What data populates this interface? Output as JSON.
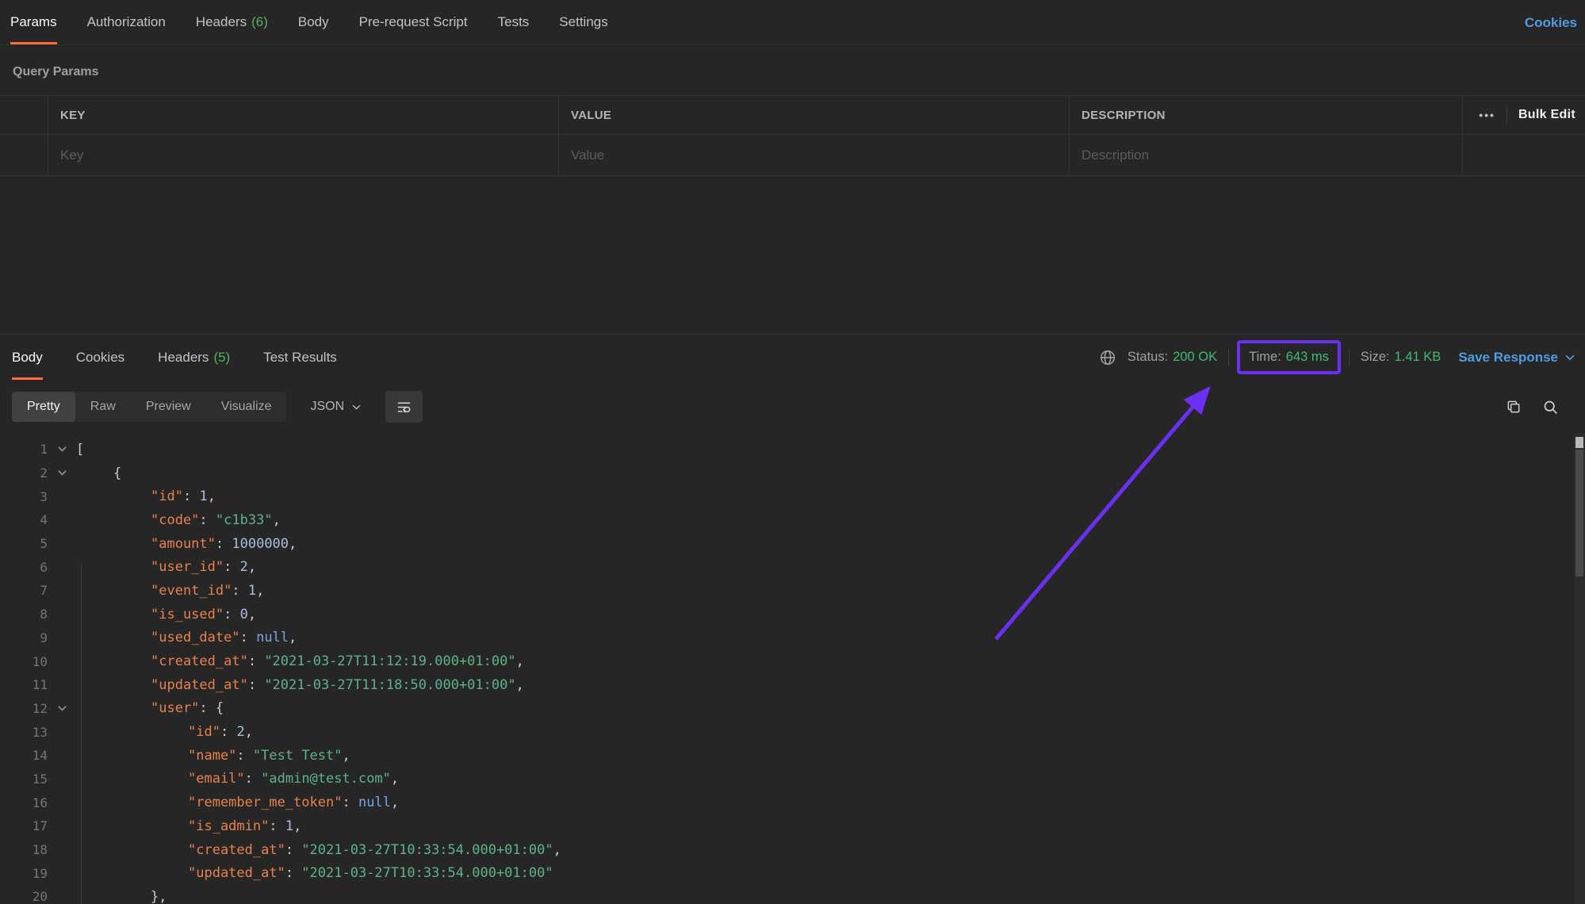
{
  "colors": {
    "accent_orange": "#ff6c37",
    "count_green": "#55b25f",
    "status_green": "#3ebd72",
    "link_blue": "#4f9ce0",
    "annotation_purple": "#6a2ff0",
    "tok_key": "#e8824d",
    "tok_str": "#5fb389",
    "tok_num": "#aabfdb",
    "tok_null": "#7ba3e3",
    "tok_punc": "#cccccc"
  },
  "request_tabs": {
    "items": [
      {
        "label": "Params"
      },
      {
        "label": "Authorization"
      },
      {
        "label": "Headers",
        "count": "(6)"
      },
      {
        "label": "Body"
      },
      {
        "label": "Pre-request Script"
      },
      {
        "label": "Tests"
      },
      {
        "label": "Settings"
      }
    ],
    "cookies_link": "Cookies"
  },
  "query_params": {
    "title": "Query Params",
    "columns": {
      "key": "KEY",
      "value": "VALUE",
      "description": "DESCRIPTION"
    },
    "more_icon": "•••",
    "bulk_edit_label": "Bulk Edit",
    "placeholders": {
      "key": "Key",
      "value": "Value",
      "description": "Description"
    }
  },
  "response": {
    "tabs": [
      {
        "label": "Body"
      },
      {
        "label": "Cookies"
      },
      {
        "label": "Headers",
        "count": "(5)"
      },
      {
        "label": "Test Results"
      }
    ],
    "status": {
      "label": "Status:",
      "value": "200 OK"
    },
    "time": {
      "label": "Time:",
      "value": "643 ms"
    },
    "size": {
      "label": "Size:",
      "value": "1.41 KB"
    },
    "save_response_label": "Save Response",
    "view_modes": [
      "Pretty",
      "Raw",
      "Preview",
      "Visualize"
    ],
    "format_selected": "JSON"
  },
  "icons": {
    "more_actions": "•••",
    "named": [
      "globe-icon",
      "chevron-down-icon",
      "text-wrap-icon",
      "copy-icon",
      "search-icon",
      "fold-chevron-icon"
    ]
  },
  "code": {
    "lines": [
      {
        "n": 1,
        "fold": true,
        "indent": 0,
        "t": [
          [
            "b",
            "["
          ]
        ]
      },
      {
        "n": 2,
        "fold": true,
        "indent": 1,
        "t": [
          [
            "b",
            "{"
          ]
        ]
      },
      {
        "n": 3,
        "fold": false,
        "indent": 2,
        "t": [
          [
            "k",
            "\"id\""
          ],
          [
            "p",
            ": "
          ],
          [
            "n",
            "1"
          ],
          [
            "p",
            ","
          ]
        ]
      },
      {
        "n": 4,
        "fold": false,
        "indent": 2,
        "t": [
          [
            "k",
            "\"code\""
          ],
          [
            "p",
            ": "
          ],
          [
            "s",
            "\"c1b33\""
          ],
          [
            "p",
            ","
          ]
        ]
      },
      {
        "n": 5,
        "fold": false,
        "indent": 2,
        "t": [
          [
            "k",
            "\"amount\""
          ],
          [
            "p",
            ": "
          ],
          [
            "n",
            "1000000"
          ],
          [
            "p",
            ","
          ]
        ]
      },
      {
        "n": 6,
        "fold": false,
        "indent": 2,
        "t": [
          [
            "k",
            "\"user_id\""
          ],
          [
            "p",
            ": "
          ],
          [
            "n",
            "2"
          ],
          [
            "p",
            ","
          ]
        ]
      },
      {
        "n": 7,
        "fold": false,
        "indent": 2,
        "t": [
          [
            "k",
            "\"event_id\""
          ],
          [
            "p",
            ": "
          ],
          [
            "n",
            "1"
          ],
          [
            "p",
            ","
          ]
        ]
      },
      {
        "n": 8,
        "fold": false,
        "indent": 2,
        "t": [
          [
            "k",
            "\"is_used\""
          ],
          [
            "p",
            ": "
          ],
          [
            "n",
            "0"
          ],
          [
            "p",
            ","
          ]
        ]
      },
      {
        "n": 9,
        "fold": false,
        "indent": 2,
        "t": [
          [
            "k",
            "\"used_date\""
          ],
          [
            "p",
            ": "
          ],
          [
            "u",
            "null"
          ],
          [
            "p",
            ","
          ]
        ]
      },
      {
        "n": 10,
        "fold": false,
        "indent": 2,
        "t": [
          [
            "k",
            "\"created_at\""
          ],
          [
            "p",
            ": "
          ],
          [
            "s",
            "\"2021-03-27T11:12:19.000+01:00\""
          ],
          [
            "p",
            ","
          ]
        ]
      },
      {
        "n": 11,
        "fold": false,
        "indent": 2,
        "t": [
          [
            "k",
            "\"updated_at\""
          ],
          [
            "p",
            ": "
          ],
          [
            "s",
            "\"2021-03-27T11:18:50.000+01:00\""
          ],
          [
            "p",
            ","
          ]
        ]
      },
      {
        "n": 12,
        "fold": true,
        "indent": 2,
        "t": [
          [
            "k",
            "\"user\""
          ],
          [
            "p",
            ": "
          ],
          [
            "b",
            "{"
          ]
        ]
      },
      {
        "n": 13,
        "fold": false,
        "indent": 3,
        "t": [
          [
            "k",
            "\"id\""
          ],
          [
            "p",
            ": "
          ],
          [
            "n",
            "2"
          ],
          [
            "p",
            ","
          ]
        ]
      },
      {
        "n": 14,
        "fold": false,
        "indent": 3,
        "t": [
          [
            "k",
            "\"name\""
          ],
          [
            "p",
            ": "
          ],
          [
            "s",
            "\"Test Test\""
          ],
          [
            "p",
            ","
          ]
        ]
      },
      {
        "n": 15,
        "fold": false,
        "indent": 3,
        "t": [
          [
            "k",
            "\"email\""
          ],
          [
            "p",
            ": "
          ],
          [
            "s",
            "\"admin@test.com\""
          ],
          [
            "p",
            ","
          ]
        ]
      },
      {
        "n": 16,
        "fold": false,
        "indent": 3,
        "t": [
          [
            "k",
            "\"remember_me_token\""
          ],
          [
            "p",
            ": "
          ],
          [
            "u",
            "null"
          ],
          [
            "p",
            ","
          ]
        ]
      },
      {
        "n": 17,
        "fold": false,
        "indent": 3,
        "t": [
          [
            "k",
            "\"is_admin\""
          ],
          [
            "p",
            ": "
          ],
          [
            "n",
            "1"
          ],
          [
            "p",
            ","
          ]
        ]
      },
      {
        "n": 18,
        "fold": false,
        "indent": 3,
        "t": [
          [
            "k",
            "\"created_at\""
          ],
          [
            "p",
            ": "
          ],
          [
            "s",
            "\"2021-03-27T10:33:54.000+01:00\""
          ],
          [
            "p",
            ","
          ]
        ]
      },
      {
        "n": 19,
        "fold": false,
        "indent": 3,
        "t": [
          [
            "k",
            "\"updated_at\""
          ],
          [
            "p",
            ": "
          ],
          [
            "s",
            "\"2021-03-27T10:33:54.000+01:00\""
          ]
        ]
      },
      {
        "n": 20,
        "fold": false,
        "indent": 2,
        "t": [
          [
            "b",
            "},"
          ]
        ]
      }
    ]
  }
}
